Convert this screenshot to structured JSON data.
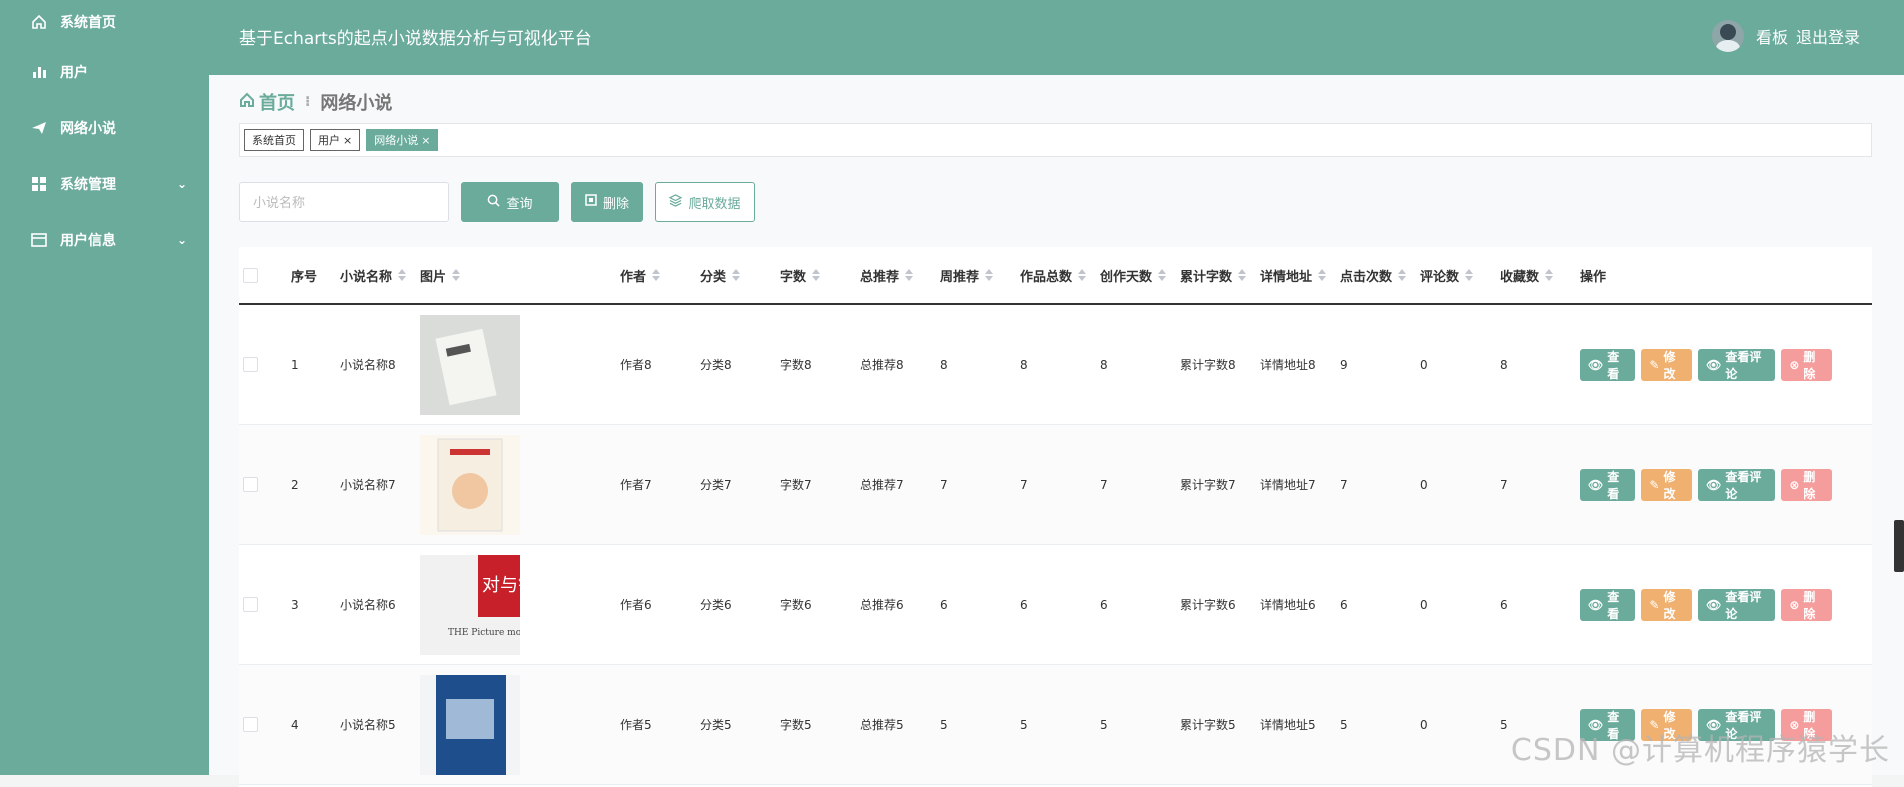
{
  "app": {
    "title": "基于Echarts的起点小说数据分析与可视化平台",
    "dashboard_label": "看板",
    "logout_label": "退出登录"
  },
  "sidebar": {
    "items": [
      {
        "label": "系统首页",
        "icon": "home-icon",
        "chevron": false
      },
      {
        "label": "用户",
        "icon": "bar-chart-icon",
        "chevron": false
      },
      {
        "label": "网络小说",
        "icon": "paper-plane-icon",
        "chevron": false
      },
      {
        "label": "系统管理",
        "icon": "grid-icon",
        "chevron": true
      },
      {
        "label": "用户信息",
        "icon": "card-icon",
        "chevron": true
      }
    ]
  },
  "breadcrumb": {
    "home": "首页",
    "current": "网络小说"
  },
  "tabs": [
    {
      "label": "系统首页",
      "closable": false,
      "active": false
    },
    {
      "label": "用户",
      "closable": true,
      "active": false
    },
    {
      "label": "网络小说",
      "closable": true,
      "active": true
    }
  ],
  "toolbar": {
    "search_placeholder": "小说名称",
    "query_label": "查询",
    "delete_label": "删除",
    "crawl_label": "爬取数据"
  },
  "table": {
    "headers": [
      "序号",
      "小说名称",
      "图片",
      "作者",
      "分类",
      "字数",
      "总推荐",
      "周推荐",
      "作品总数",
      "创作天数",
      "累计字数",
      "详情地址",
      "点击次数",
      "评论数",
      "收藏数",
      "操作"
    ],
    "actions": {
      "view": "查看",
      "edit": "修改",
      "comments": "查看评论",
      "delete": "删除"
    },
    "rows": [
      {
        "no": "1",
        "name": "小说名称8",
        "author": "作者8",
        "category": "分类8",
        "words": "字数8",
        "total_rec": "总推荐8",
        "week_rec": "8",
        "works": "8",
        "days": "8",
        "acc_words": "累计字数8",
        "detail": "详情地址8",
        "clicks": "9",
        "comments": "0",
        "favorites": "8",
        "cover": "white-box"
      },
      {
        "no": "2",
        "name": "小说名称7",
        "author": "作者7",
        "category": "分类7",
        "words": "字数7",
        "total_rec": "总推荐7",
        "week_rec": "7",
        "works": "7",
        "days": "7",
        "acc_words": "累计字数7",
        "detail": "详情地址7",
        "clicks": "7",
        "comments": "0",
        "favorites": "7",
        "cover": "illustrated"
      },
      {
        "no": "3",
        "name": "小说名称6",
        "author": "作者6",
        "category": "分类6",
        "words": "字数6",
        "total_rec": "总推荐6",
        "week_rec": "6",
        "works": "6",
        "days": "6",
        "acc_words": "累计字数6",
        "detail": "详情地址6",
        "clicks": "6",
        "comments": "0",
        "favorites": "6",
        "cover": "red-white"
      },
      {
        "no": "4",
        "name": "小说名称5",
        "author": "作者5",
        "category": "分类5",
        "words": "字数5",
        "total_rec": "总推荐5",
        "week_rec": "5",
        "works": "5",
        "days": "5",
        "acc_words": "累计字数5",
        "detail": "详情地址5",
        "clicks": "5",
        "comments": "0",
        "favorites": "5",
        "cover": "blue"
      }
    ]
  },
  "cover_text": {
    "row3_title": "对与错",
    "row3_sub": "THE Picture monster"
  },
  "watermark": "CSDN @计算机程序猿学长",
  "colors": {
    "primary": "#6aab9c",
    "edit": "#f0b070",
    "delete": "#f59c9c"
  }
}
